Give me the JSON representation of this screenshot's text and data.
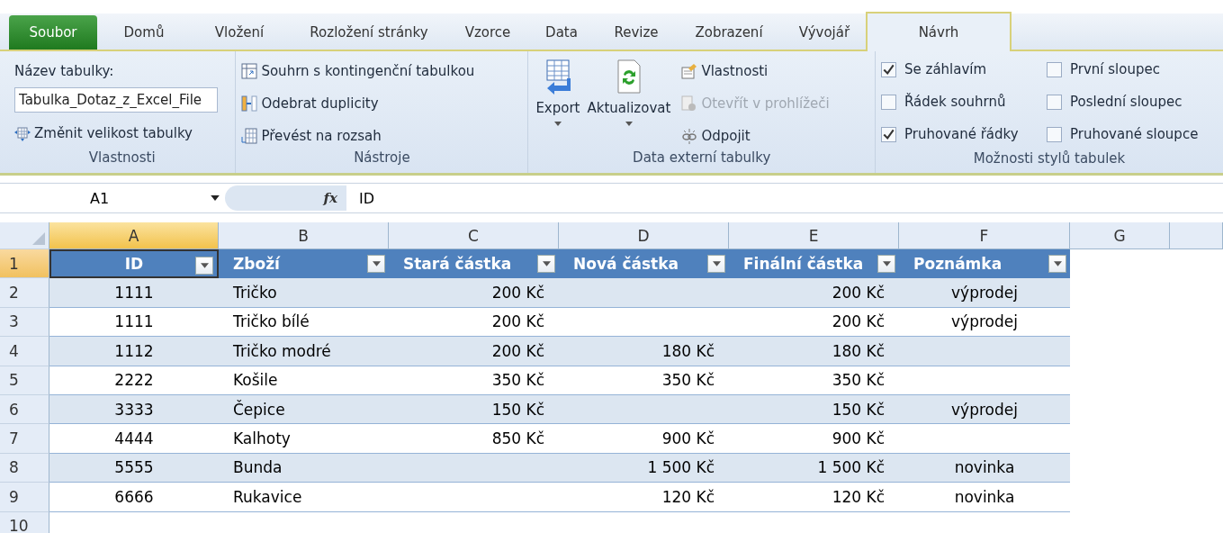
{
  "tabs": [
    {
      "label": "Soubor",
      "kind": "file",
      "selected": false
    },
    {
      "label": "Domů",
      "kind": "tab",
      "selected": false
    },
    {
      "label": "Vložení",
      "kind": "tab",
      "selected": false
    },
    {
      "label": "Rozložení stránky",
      "kind": "tab",
      "selected": false
    },
    {
      "label": "Vzorce",
      "kind": "tab",
      "selected": false
    },
    {
      "label": "Data",
      "kind": "tab",
      "selected": false
    },
    {
      "label": "Revize",
      "kind": "tab",
      "selected": false
    },
    {
      "label": "Zobrazení",
      "kind": "tab",
      "selected": false
    },
    {
      "label": "Vývojář",
      "kind": "tab",
      "selected": false
    },
    {
      "label": "Návrh",
      "kind": "tab",
      "selected": true
    }
  ],
  "ribbon": {
    "properties": {
      "label": "Vlastnosti",
      "name_label": "Název tabulky:",
      "name_value": "Tabulka_Dotaz_z_Excel_File",
      "resize": "Změnit velikost tabulky"
    },
    "tools": {
      "label": "Nástroje",
      "items": [
        {
          "label": "Souhrn s kontingenční tabulkou",
          "kind": "pivot"
        },
        {
          "label": "Odebrat duplicity",
          "kind": "dedupe"
        },
        {
          "label": "Převést na rozsah",
          "kind": "convert"
        }
      ]
    },
    "external": {
      "label": "Data externí tabulky",
      "big": [
        {
          "label": "Export",
          "kind": "export"
        },
        {
          "label": "Aktualizovat",
          "kind": "refresh"
        }
      ],
      "items": [
        {
          "label": "Vlastnosti",
          "kind": "props",
          "disabled": false
        },
        {
          "label": "Otevřít v prohlížeči",
          "kind": "browser",
          "disabled": true
        },
        {
          "label": "Odpojit",
          "kind": "unlink",
          "disabled": false
        }
      ]
    },
    "styles": {
      "label": "Možnosti stylů tabulek",
      "options": [
        {
          "label": "Se záhlavím",
          "checked": true
        },
        {
          "label": "Řádek souhrnů",
          "checked": false
        },
        {
          "label": "Pruhované řádky",
          "checked": true
        },
        {
          "label": "První sloupec",
          "checked": false
        },
        {
          "label": "Poslední sloupec",
          "checked": false
        },
        {
          "label": "Pruhované sloupce",
          "checked": false
        }
      ]
    }
  },
  "formula_bar": {
    "name_box": "A1",
    "fx": "fx",
    "formula": "ID"
  },
  "sheet": {
    "columns": [
      {
        "label": "A",
        "selected": true
      },
      {
        "label": "B",
        "selected": false
      },
      {
        "label": "C",
        "selected": false
      },
      {
        "label": "D",
        "selected": false
      },
      {
        "label": "E",
        "selected": false
      },
      {
        "label": "F",
        "selected": false
      },
      {
        "label": "G",
        "selected": false
      }
    ],
    "header_row": {
      "number": "1",
      "selected": true,
      "cells": [
        "ID",
        "Zboží",
        "Stará částka",
        "Nová částka",
        "Finální částka",
        "Poznámka"
      ]
    },
    "rows": [
      {
        "number": "2",
        "selected": false,
        "cells": [
          "1111",
          "Tričko",
          "200 Kč",
          null,
          "200 Kč",
          "výprodej"
        ]
      },
      {
        "number": "3",
        "selected": false,
        "cells": [
          "1111",
          "Tričko bílé",
          "200 Kč",
          null,
          "200 Kč",
          "výprodej"
        ]
      },
      {
        "number": "4",
        "selected": false,
        "cells": [
          "1112",
          "Tričko modré",
          "200 Kč",
          "180 Kč",
          "180 Kč",
          null
        ]
      },
      {
        "number": "5",
        "selected": false,
        "cells": [
          "2222",
          "Košile",
          "350 Kč",
          "350 Kč",
          "350 Kč",
          null
        ]
      },
      {
        "number": "6",
        "selected": false,
        "cells": [
          "3333",
          "Čepice",
          "150 Kč",
          null,
          "150 Kč",
          "výprodej"
        ]
      },
      {
        "number": "7",
        "selected": false,
        "cells": [
          "4444",
          "Kalhoty",
          "850 Kč",
          "900 Kč",
          "900 Kč",
          null
        ]
      },
      {
        "number": "8",
        "selected": false,
        "cells": [
          "5555",
          "Bunda",
          null,
          "1 500 Kč",
          "1 500 Kč",
          "novinka"
        ]
      },
      {
        "number": "9",
        "selected": false,
        "cells": [
          "6666",
          "Rukavice",
          null,
          "120 Kč",
          "120 Kč",
          "novinka"
        ]
      }
    ],
    "empty_rows": [
      {
        "number": "10",
        "selected": false
      }
    ]
  }
}
